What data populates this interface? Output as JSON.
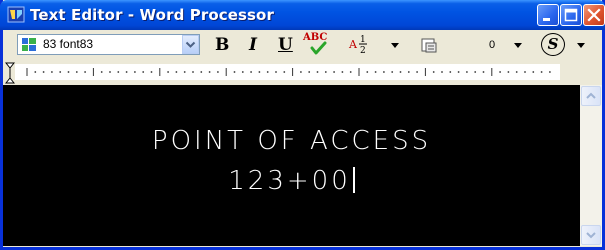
{
  "window": {
    "title": "Text Editor - Word Processor",
    "title_color": "#ffffff",
    "titlebar_color": "#0054e3"
  },
  "toolbar": {
    "font_select": {
      "value": "83 font83"
    },
    "bold_label": "B",
    "italic_label": "I",
    "underline_label": "U",
    "spell_label": "ABC",
    "fraction_label": "A",
    "fraction_num": "1",
    "fraction_den": "2",
    "number_value": "0",
    "symbol_label": "S"
  },
  "editor": {
    "lines": [
      "POINT OF ACCESS",
      "123+00"
    ],
    "background": "#000000",
    "text_color": "#ffffff"
  },
  "icons": [
    "app-icon",
    "font-icon",
    "minimize-icon",
    "maximize-icon",
    "close-icon",
    "spellcheck-icon",
    "fraction-icon",
    "insert-icon",
    "symbol-icon"
  ]
}
